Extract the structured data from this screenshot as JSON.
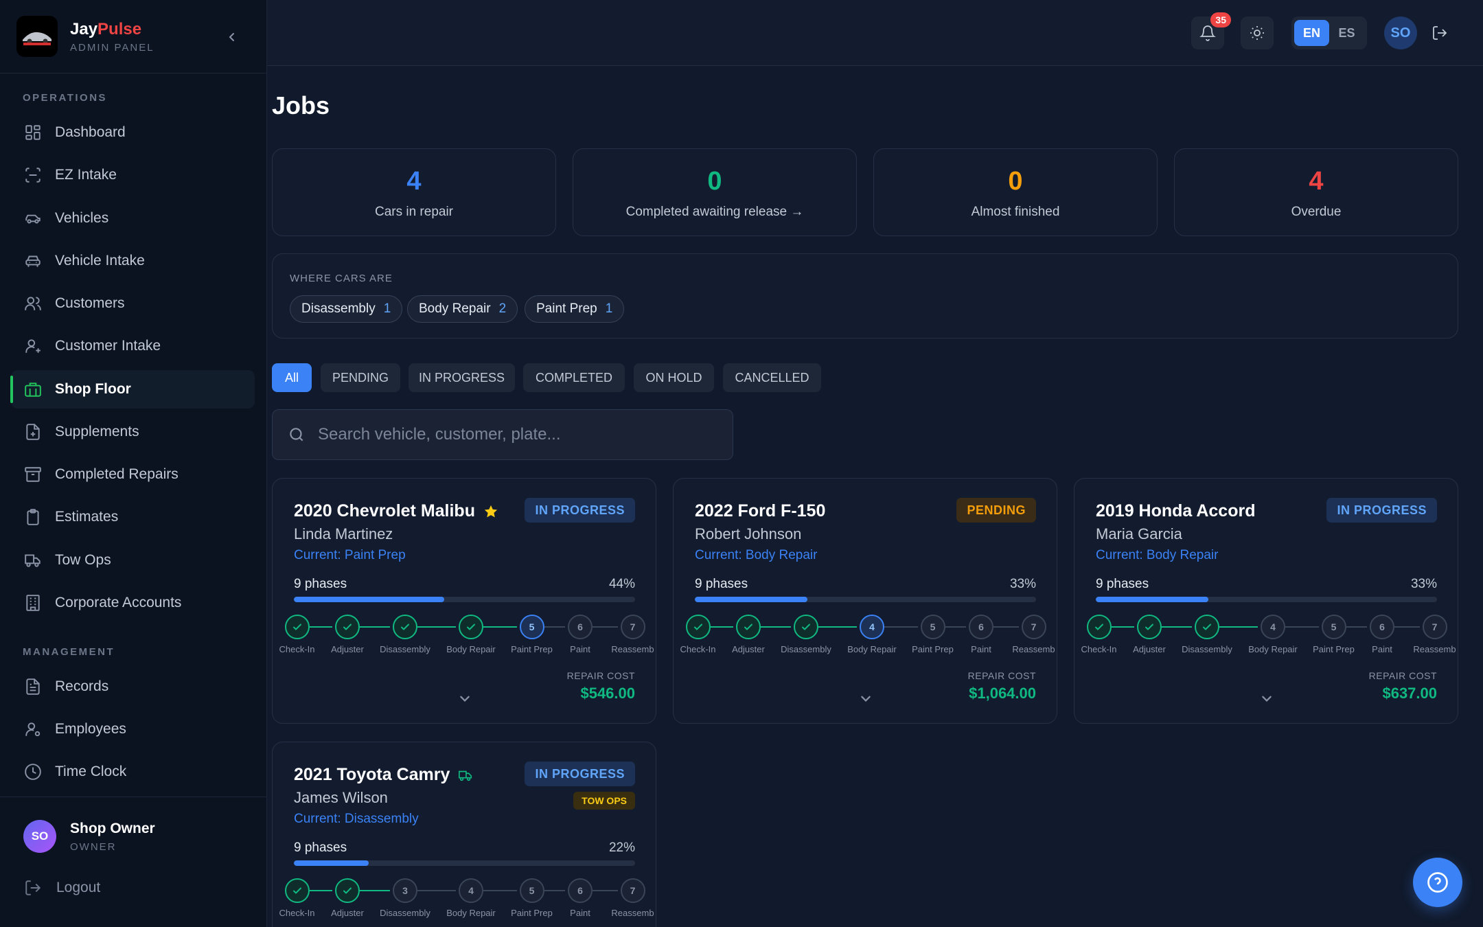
{
  "brand": {
    "name_main": "Jay",
    "name_accent": "Pulse",
    "subtitle": "ADMIN PANEL",
    "logo_text": "JAY"
  },
  "sidebar": {
    "operations_label": "OPERATIONS",
    "management_label": "MANAGEMENT",
    "operations": [
      {
        "label": "Dashboard",
        "icon": "dashboard-icon"
      },
      {
        "label": "EZ Intake",
        "icon": "scan-icon"
      },
      {
        "label": "Vehicles",
        "icon": "car-icon"
      },
      {
        "label": "Vehicle Intake",
        "icon": "car-front-icon"
      },
      {
        "label": "Customers",
        "icon": "users-icon"
      },
      {
        "label": "Customer Intake",
        "icon": "user-plus-icon"
      },
      {
        "label": "Shop Floor",
        "icon": "briefcase-icon",
        "active": true
      },
      {
        "label": "Supplements",
        "icon": "file-plus-icon"
      },
      {
        "label": "Completed Repairs",
        "icon": "archive-icon"
      },
      {
        "label": "Estimates",
        "icon": "clipboard-icon"
      },
      {
        "label": "Tow Ops",
        "icon": "truck-icon"
      },
      {
        "label": "Corporate Accounts",
        "icon": "building-icon"
      }
    ],
    "management": [
      {
        "label": "Records",
        "icon": "file-text-icon"
      },
      {
        "label": "Employees",
        "icon": "user-cog-icon"
      },
      {
        "label": "Time Clock",
        "icon": "clock-icon"
      }
    ],
    "user": {
      "initials": "SO",
      "name": "Shop Owner",
      "role": "OWNER"
    },
    "logout_label": "Logout"
  },
  "topbar": {
    "notification_count": "35",
    "languages": [
      "EN",
      "ES"
    ],
    "selected_language": "EN",
    "avatar_initials": "SO"
  },
  "page": {
    "title": "Jobs"
  },
  "stats": [
    {
      "value": "4",
      "label": "Cars in repair",
      "color": "#3b82f6"
    },
    {
      "value": "0",
      "label": "Completed awaiting release →",
      "color": "#10b981"
    },
    {
      "value": "0",
      "label": "Almost finished",
      "color": "#f59e0b"
    },
    {
      "value": "4",
      "label": "Overdue",
      "color": "#ef4444"
    }
  ],
  "where": {
    "title": "WHERE CARS ARE",
    "chips": [
      {
        "label": "Disassembly",
        "count": "1"
      },
      {
        "label": "Body Repair",
        "count": "2"
      },
      {
        "label": "Paint Prep",
        "count": "1"
      }
    ]
  },
  "filters": [
    "All",
    "PENDING",
    "IN PROGRESS",
    "COMPLETED",
    "ON HOLD",
    "CANCELLED"
  ],
  "selected_filter": "All",
  "search": {
    "placeholder": "Search vehicle, customer, plate..."
  },
  "step_labels": [
    "Check-In",
    "Adjuster",
    "Disassembly",
    "Body Repair",
    "Paint Prep",
    "Paint",
    "Reassemb"
  ],
  "jobs": [
    {
      "title": "2020 Chevrolet Malibu",
      "title_icon": "star-icon",
      "customer": "Linda Martinez",
      "current": "Current: Paint Prep",
      "status": "IN PROGRESS",
      "phases": "9 phases",
      "percent": "44%",
      "progress": 0.44,
      "completed_steps": 4,
      "current_step": 5,
      "cost_label": "REPAIR COST",
      "cost": "$546.00"
    },
    {
      "title": "2022 Ford F-150",
      "customer": "Robert Johnson",
      "current": "Current: Body Repair",
      "status": "PENDING",
      "phases": "9 phases",
      "percent": "33%",
      "progress": 0.33,
      "completed_steps": 3,
      "current_step": 4,
      "cost_label": "REPAIR COST",
      "cost": "$1,064.00"
    },
    {
      "title": "2019 Honda Accord",
      "customer": "Maria Garcia",
      "current": "Current: Body Repair",
      "status": "IN PROGRESS",
      "phases": "9 phases",
      "percent": "33%",
      "progress": 0.33,
      "completed_steps": 3,
      "current_step": 0,
      "cost_label": "REPAIR COST",
      "cost": "$637.00"
    },
    {
      "title": "2021 Toyota Camry",
      "title_icon": "truck-icon",
      "customer": "James Wilson",
      "current": "Current: Disassembly",
      "status": "IN PROGRESS",
      "tag": "TOW OPS",
      "phases": "9 phases",
      "percent": "22%",
      "progress": 0.22,
      "completed_steps": 2,
      "current_step": 0
    }
  ]
}
